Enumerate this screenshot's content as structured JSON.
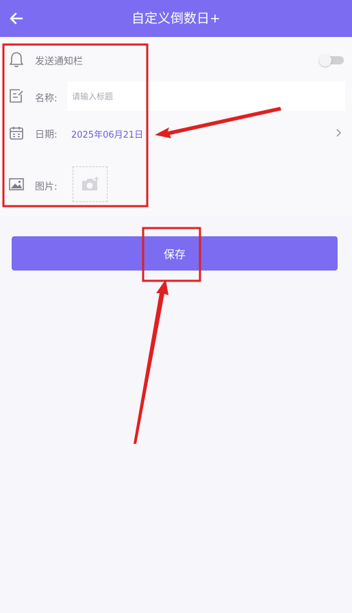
{
  "header": {
    "title": "自定义倒数日+",
    "back_icon": "arrow-left-icon"
  },
  "form": {
    "notify": {
      "label": "发送通知栏",
      "enabled": false,
      "icon": "bell-icon"
    },
    "name": {
      "label": "名称:",
      "placeholder": "请输入标题",
      "value": "",
      "icon": "edit-note-icon"
    },
    "date": {
      "label": "日期:",
      "value": "2025年06月21日",
      "icon": "calendar-icon"
    },
    "image": {
      "label": "图片:",
      "icon": "image-icon",
      "add_icon": "camera-add-icon"
    }
  },
  "actions": {
    "save_label": "保存"
  },
  "colors": {
    "accent": "#7b6cf1",
    "annotation": "#e02020"
  }
}
